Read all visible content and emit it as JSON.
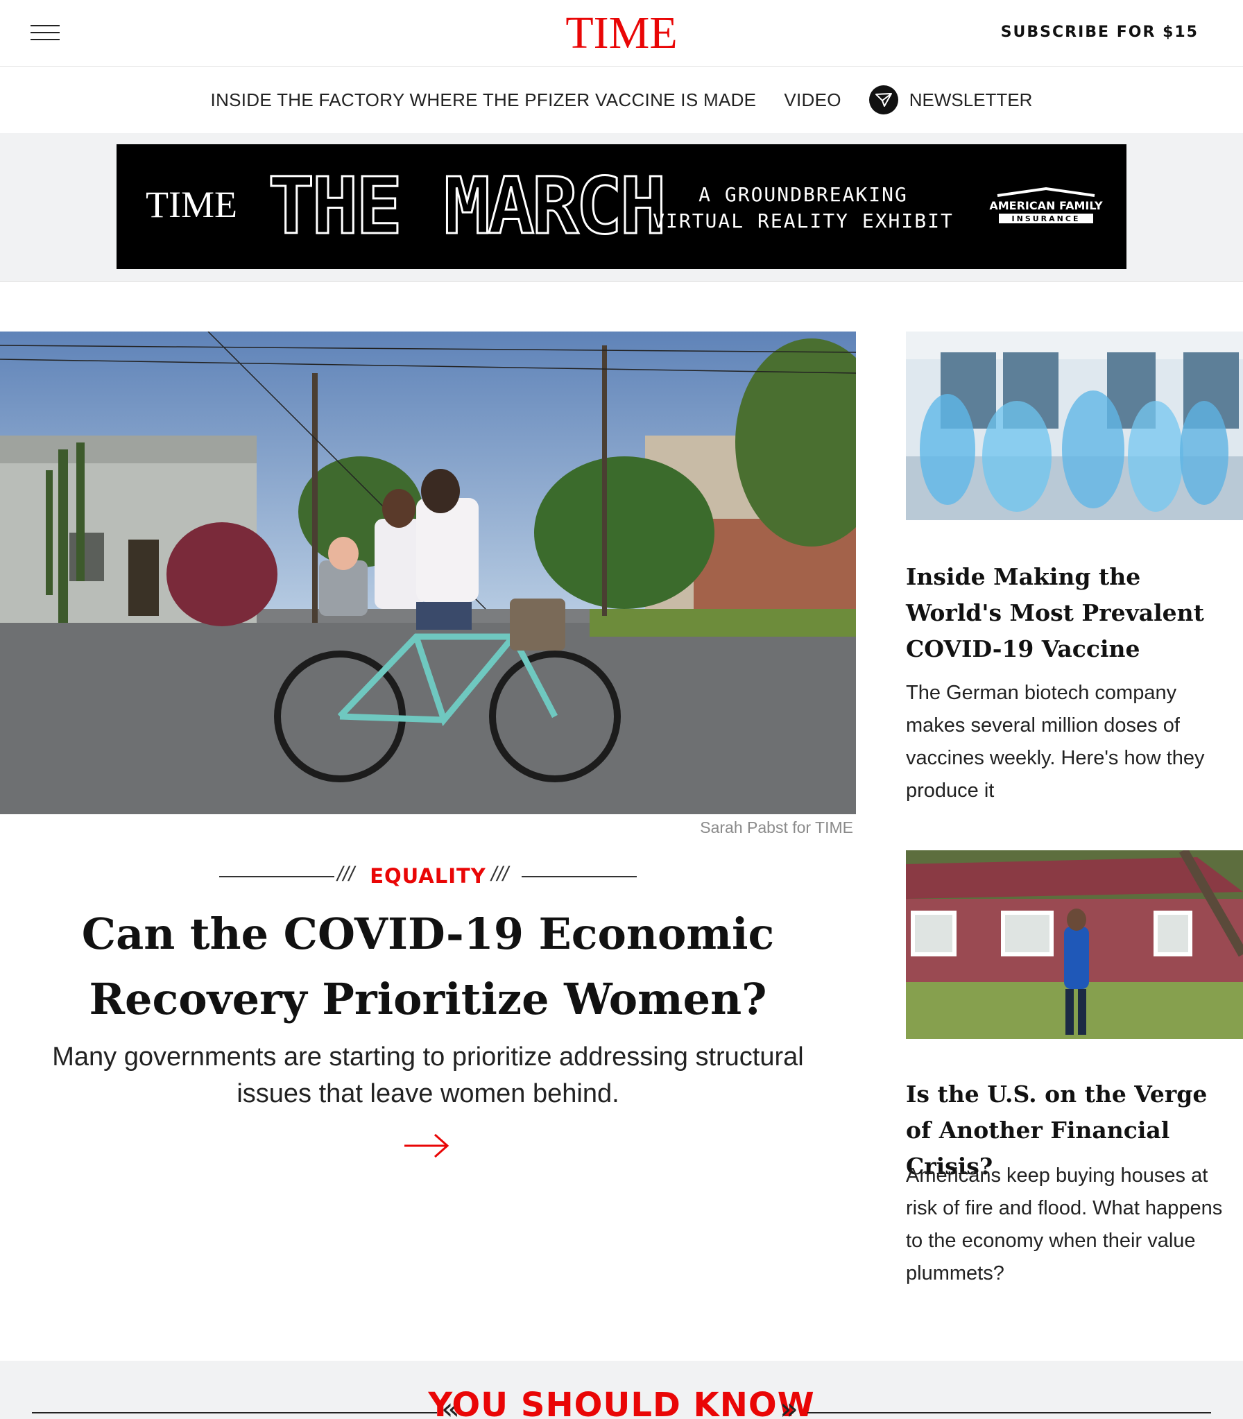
{
  "header": {
    "logo": "TIME",
    "subscribe_label": "SUBSCRIBE FOR $15"
  },
  "subnav": {
    "links": [
      "INSIDE THE FACTORY WHERE THE PFIZER VACCINE IS MADE",
      "VIDEO"
    ],
    "newsletter_label": "NEWSLETTER"
  },
  "ad": {
    "brand": "TIME",
    "title": "THE MARCH",
    "tagline_line1": "A GROUNDBREAKING",
    "tagline_line2": "VIRTUAL REALITY EXHIBIT",
    "sponsor_line1": "AMERICAN FAMILY",
    "sponsor_line2": "INSURANCE"
  },
  "hero": {
    "photo_credit": "Sarah Pabst for TIME",
    "kicker": "EQUALITY",
    "title": "Can the COVID-19 Economic Recovery Prioritize Women?",
    "dek": "Many governments are starting to prioritize addressing structural issues that leave women behind."
  },
  "sidebar": [
    {
      "title": "Inside Making the World's Most Prevalent COVID-19 Vaccine",
      "dek": "The German biotech company makes several million doses of vaccines weekly. Here's how they produce it"
    },
    {
      "title": "Is the U.S. on the Verge of Another Financial Crisis?",
      "dek": "Americans keep buying houses at risk of fire and flood. What happens to the economy when their value plummets?"
    }
  ],
  "section": {
    "heading": "YOU SHOULD KNOW"
  },
  "colors": {
    "brand_red": "#e90606",
    "text": "#111111",
    "band_gray": "#f1f2f3"
  },
  "icons": [
    "hamburger-menu-icon",
    "newsletter-send-icon",
    "arrow-right-icon",
    "chevron-left-double-icon",
    "chevron-right-double-icon"
  ]
}
